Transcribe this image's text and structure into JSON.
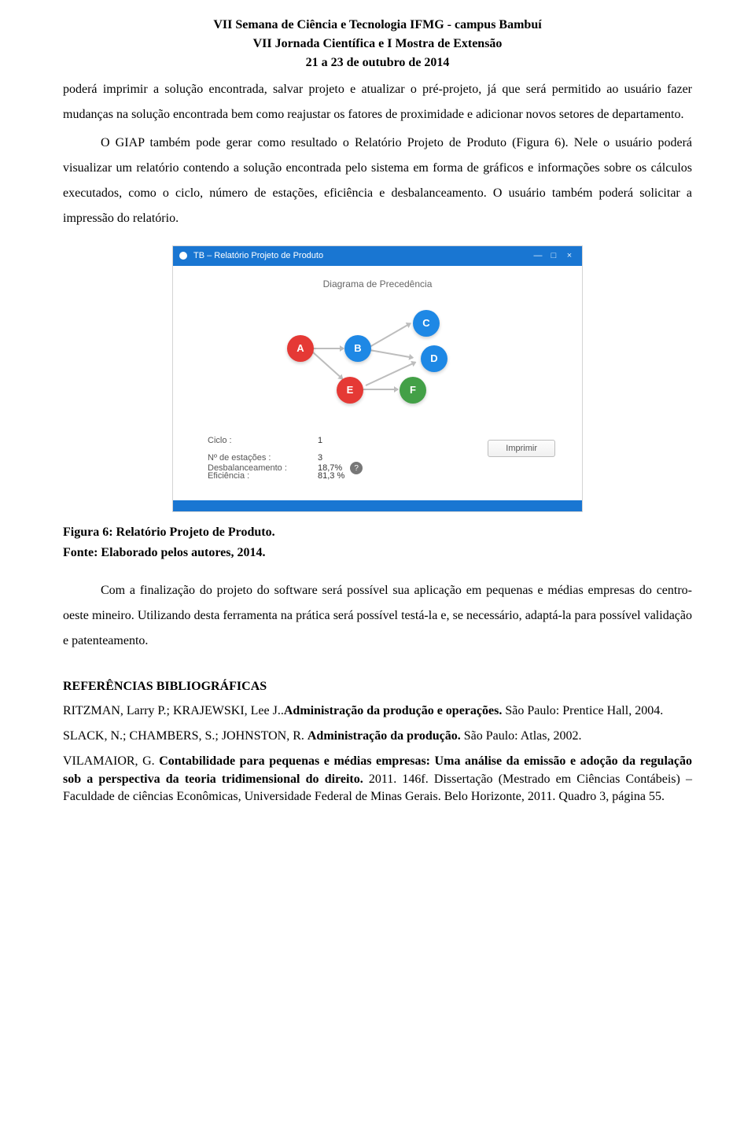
{
  "header": {
    "line1": "VII Semana de Ciência e Tecnologia IFMG - campus Bambuí",
    "line2": "VII Jornada Científica e I Mostra de Extensão",
    "line3": "21 a 23 de outubro de 2014"
  },
  "paragraphs": {
    "p1": "poderá imprimir a solução encontrada, salvar projeto e atualizar o pré-projeto, já que será permitido ao usuário fazer mudanças na solução encontrada bem como reajustar os fatores de proximidade e adicionar novos setores de departamento.",
    "p2": "O GIAP também pode gerar como resultado o Relatório Projeto de Produto (Figura 6). Nele o usuário poderá visualizar um relatório contendo a solução encontrada pelo sistema em forma de gráficos e informações sobre os cálculos executados, como o ciclo, número de estações, eficiência e desbalanceamento. O usuário também poderá solicitar a impressão do relatório.",
    "p3": "Com a finalização do projeto do software será possível sua aplicação em pequenas e médias empresas do centro-oeste mineiro. Utilizando desta ferramenta na prática será possível testá-la e, se necessário, adaptá-la para possível validação e patenteamento."
  },
  "figure": {
    "caption_line1": "Figura 6: Relatório Projeto de Produto.",
    "caption_line2": "Fonte: Elaborado pelos autores, 2014.",
    "window_title": "TB – Relatório Projeto de Produto",
    "diagram_title": "Diagrama de Precedência",
    "nodes": {
      "A": "A",
      "B": "B",
      "C": "C",
      "D": "D",
      "E": "E",
      "F": "F"
    },
    "stats": {
      "ciclo_label": "Ciclo :",
      "ciclo_val": "1",
      "estacoes_label": "Nº de estações :",
      "estacoes_val": "3",
      "eficiencia_label": "Eficiência :",
      "eficiencia_val": "81,3 %",
      "desbal_label": "Desbalanceamento :",
      "desbal_val": "18,7%"
    },
    "print_btn": "Imprimir",
    "help_icon": "?"
  },
  "references_title": "REFERÊNCIAS BIBLIOGRÁFICAS",
  "refs": {
    "r1a": "RITZMAN, Larry P.; KRAJEWSKI, Lee J..",
    "r1b": "Administração da produção e operações.",
    "r1c": " São Paulo: Prentice Hall, 2004.",
    "r2a": "SLACK, N.; CHAMBERS, S.; JOHNSTON, R. ",
    "r2b": "Administração da produção.",
    "r2c": " São Paulo: Atlas, 2002.",
    "r3a": "VILAMAIOR, G. ",
    "r3b": "Contabilidade para pequenas e médias empresas: Uma análise da emissão e adoção da regulação sob a perspectiva da teoria tridimensional do direito.",
    "r3c": " 2011. 146f. Dissertação (Mestrado em Ciências Contábeis) – Faculdade de ciências Econômicas, Universidade Federal de Minas Gerais. Belo Horizonte, 2011. Quadro 3, página 55."
  }
}
